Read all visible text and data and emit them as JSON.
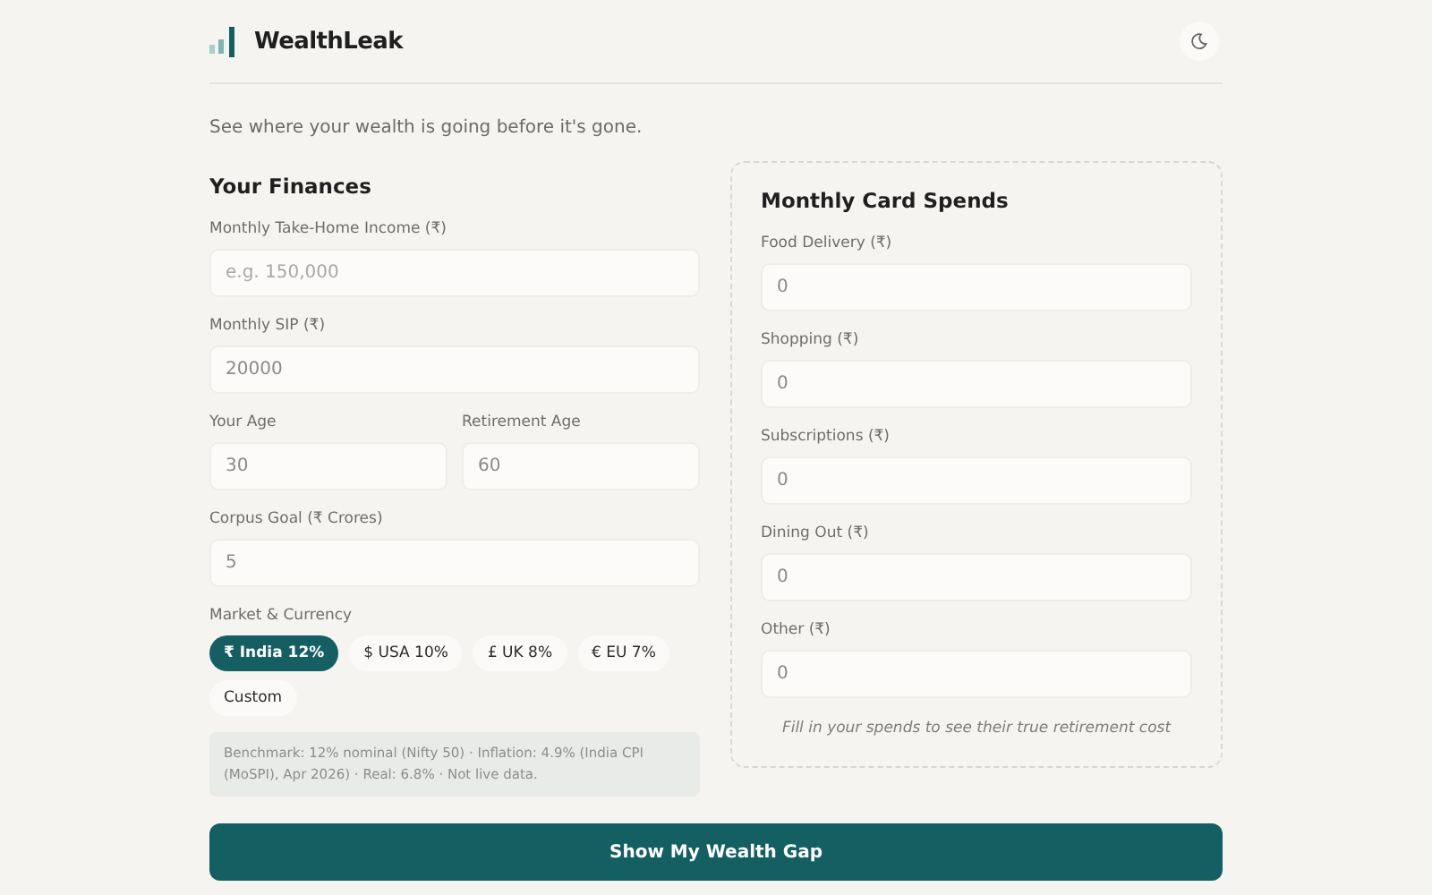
{
  "header": {
    "brand": "WealthLeak"
  },
  "tagline": "See where your wealth is going before it's gone.",
  "finances": {
    "title": "Your Finances",
    "fields": [
      {
        "label": "Monthly Take-Home Income (₹)",
        "placeholder": "e.g. 150,000"
      },
      {
        "label": "Monthly SIP (₹)",
        "value": "20000"
      },
      {
        "label": "Your Age",
        "value": "30",
        "half": true
      },
      {
        "label": "Retirement Age",
        "value": "60",
        "half": true
      },
      {
        "label": "Corpus Goal (₹ Crores)",
        "value": "5"
      }
    ],
    "market_label": "Market & Currency",
    "markets": [
      {
        "label": "₹ India 12%",
        "selected": true
      },
      {
        "label": "$ USA 10%",
        "selected": false
      },
      {
        "label": "£ UK 8%",
        "selected": false
      },
      {
        "label": "€ EU 7%",
        "selected": false
      },
      {
        "label": "Custom",
        "selected": false
      }
    ],
    "note": "Benchmark: 12% nominal (Nifty 50) · Inflation: 4.9% (India CPI (MoSPI), Apr 2026) · Real: 6.8% · Not live data."
  },
  "spends": {
    "title": "Monthly Card Spends",
    "fields": [
      {
        "label": "Food Delivery (₹)",
        "value": "0"
      },
      {
        "label": "Shopping (₹)",
        "value": "0"
      },
      {
        "label": "Subscriptions (₹)",
        "value": "0"
      },
      {
        "label": "Dining Out (₹)",
        "value": "0"
      },
      {
        "label": "Other (₹)",
        "value": "0"
      }
    ],
    "hint": "Fill in your spends to see their true retirement cost"
  },
  "submit": "Show My Wealth Gap"
}
